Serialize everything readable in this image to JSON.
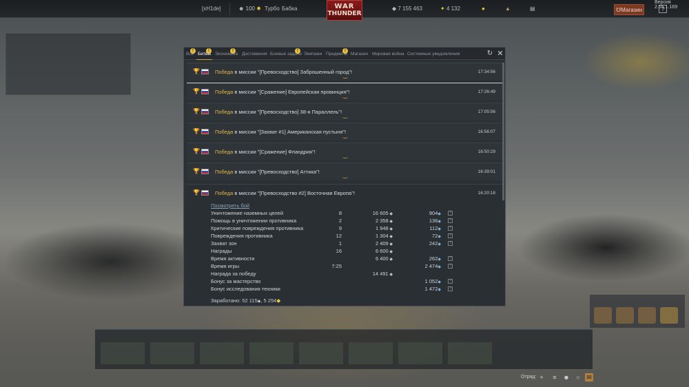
{
  "version": "Версия 2.55.1.169",
  "topbar": {
    "player": "[xH1de]",
    "squad_points": "100",
    "mode": "Турбо",
    "title_label": "Бабка",
    "logo_line1": "WAR",
    "logo_line2": "THUNDER",
    "silver": "7 155 463",
    "gold": "4 132",
    "shop_label": "Магазин",
    "help_label": "?"
  },
  "tabs": [
    {
      "label": "Все",
      "badge": "!"
    },
    {
      "label": "Битвы",
      "badge": "!",
      "active": true
    },
    {
      "label": "Экономика",
      "badge": "!"
    },
    {
      "label": "Достижения"
    },
    {
      "label": "Боевые задачи",
      "badge": "!"
    },
    {
      "label": "Экипажи"
    },
    {
      "label": "Предметы",
      "badge": "!"
    },
    {
      "label": "Магазин"
    },
    {
      "label": "Мировая война"
    },
    {
      "label": "Системные уведомления"
    }
  ],
  "battles": [
    {
      "win": "Победа",
      "rest": " в миссии \"[Превосходство] Заброшенный город\"!",
      "time": "17:34:56"
    },
    {
      "win": "Победа",
      "rest": " в миссии \"[Сражение] Европейская провинция\"!",
      "time": "17:26:49"
    },
    {
      "win": "Победа",
      "rest": " в миссии \"[Превосходство] 38-я Параллель\"!",
      "time": "17:05:56"
    },
    {
      "win": "Победа",
      "rest": " в миссии \"[Захват #1] Американская пустыня\"!",
      "time": "16:56:07"
    },
    {
      "win": "Победа",
      "rest": " в миссии \"[Сражение] Фландрия\"!",
      "time": "16:50:29"
    },
    {
      "win": "Победа",
      "rest": " в миссии \"[Превосходство] Аттика\"!",
      "time": "16:39:01"
    }
  ],
  "expanded": {
    "win": "Победа",
    "rest": " в миссии \"[Превосходство #2] Восточная Европа\"!",
    "time": "16:20:18",
    "watch": "Посмотреть бой",
    "rows": [
      {
        "label": "Уничтожение наземных целей",
        "count": "8",
        "sl": "16 605",
        "rp": "904"
      },
      {
        "label": "Помощь в уничтожении противника",
        "count": "2",
        "sl": "2 358",
        "rp": "136"
      },
      {
        "label": "Критические повреждения противника",
        "count": "9",
        "sl": "1 948",
        "rp": "112"
      },
      {
        "label": "Повреждения противника",
        "count": "12",
        "sl": "1 304",
        "rp": "72"
      },
      {
        "label": "Захват зон",
        "count": "1",
        "sl": "2 409",
        "rp": "242"
      },
      {
        "label": "Награды",
        "count": "16",
        "sl": "6 600",
        "rp": ""
      },
      {
        "label": "Время активности",
        "count": "",
        "sl": "6 400",
        "rp": "262"
      },
      {
        "label": "Время игры",
        "count": "7:25",
        "sl": "",
        "rp": "2 474"
      },
      {
        "label": "Награда за победу",
        "count": "",
        "sl": "14 491",
        "rp": ""
      },
      {
        "label": "Бонус за мастерство",
        "count": "",
        "sl": "",
        "rp": "1 052"
      },
      {
        "label": "Бонус исследования техники",
        "count": "",
        "sl": "",
        "rp": "1 472"
      }
    ],
    "earned_label": "Заработано:",
    "earned_sl": "52 115",
    "earned_rp": "5 254"
  },
  "bottom": {
    "squad_label": "Отряд:"
  },
  "colors": {
    "win_text": "#e3b94a",
    "rp_icon": "#7ab0e0",
    "tab_badge": "#e8c040",
    "shop": "#7a3a24"
  }
}
